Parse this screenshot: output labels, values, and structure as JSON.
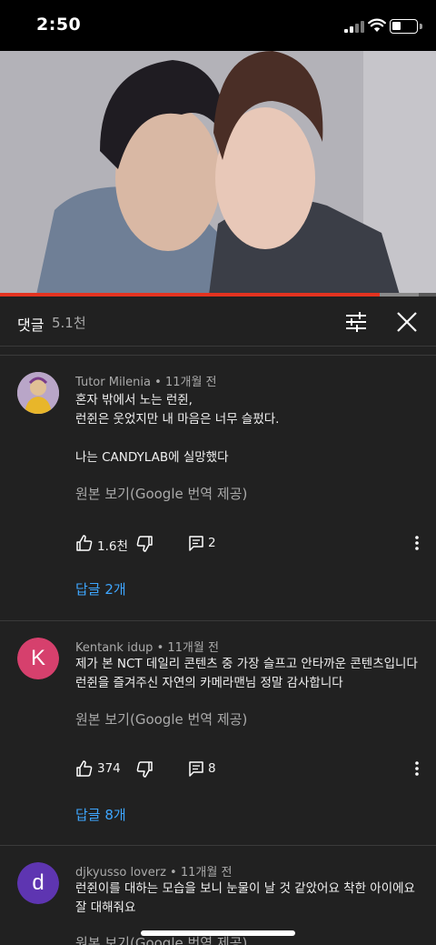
{
  "status_bar": {
    "time": "2:50"
  },
  "panel": {
    "title": "댓글",
    "count": "5.1천"
  },
  "progress": {
    "played_fraction": 0.87,
    "buffered_fraction": 0.96
  },
  "comments": [
    {
      "author": "Tutor Milenia",
      "time": "11개월 전",
      "text": "혼자 밖에서 노는 런쥔,\n런쥔은 웃었지만 내 마음은 너무 슬펐다.\n\n나는 CANDYLAB에 실망했다",
      "translate_label": "원본 보기(Google 번역 제공)",
      "likes": "1.6천",
      "reply_count": "2",
      "replies_link": "답글 2개",
      "avatar_type": "photo"
    },
    {
      "author": "Kentank idup",
      "time": "11개월 전",
      "text": "제가 본 NCT 데일리 콘텐츠 중 가장 슬프고 안타까운 콘텐츠입니다 런쥔을 즐겨주신 자연의 카메라맨님 정말 감사합니다",
      "translate_label": "원본 보기(Google 번역 제공)",
      "likes": "374",
      "reply_count": "8",
      "replies_link": "답글 8개",
      "avatar_letter": "K",
      "avatar_color": "#d6406d"
    },
    {
      "author": "djkyusso loverz",
      "time": "11개월 전",
      "text": "런쥔이를 대하는 모습을 보니 눈물이 날 것 같았어요 착한 아이에요 잘 대해줘요",
      "translate_label": "원본 보기(Google 번역 제공)",
      "avatar_letter": "d",
      "avatar_color": "#5e35b1"
    }
  ],
  "meta_separator": " • ",
  "icons": {
    "like": "thumb-up-icon",
    "dislike": "thumb-down-icon",
    "reply": "comment-icon",
    "more": "more-vert-icon",
    "filter": "filter-sliders-icon",
    "close": "close-icon"
  },
  "colors": {
    "background": "#212121",
    "link": "#3ea6ff",
    "progress": "#e33320"
  }
}
